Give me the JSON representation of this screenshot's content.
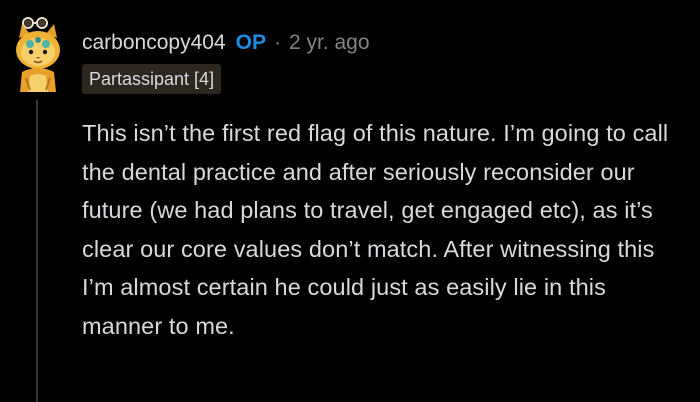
{
  "comment": {
    "author": {
      "username": "carboncopy404",
      "op_label": "OP",
      "avatar_icon": "cat-avatar-icon"
    },
    "separator": "·",
    "timestamp": "2 yr. ago",
    "flair": "Partassipant [4]",
    "body": "This isn’t the first red flag of this nature. I’m going to call the dental practice and after seriously reconsider our future (we had plans to travel, get engaged etc), as it’s clear our core values don’t match. After witnessing this I’m almost certain he could just as easily lie in this manner to me."
  },
  "colors": {
    "background": "#000000",
    "text": "#d7dadc",
    "muted": "#818384",
    "op_blue": "#1d8ce0",
    "flair_bg": "#2e2720",
    "thread_line": "#343536"
  }
}
